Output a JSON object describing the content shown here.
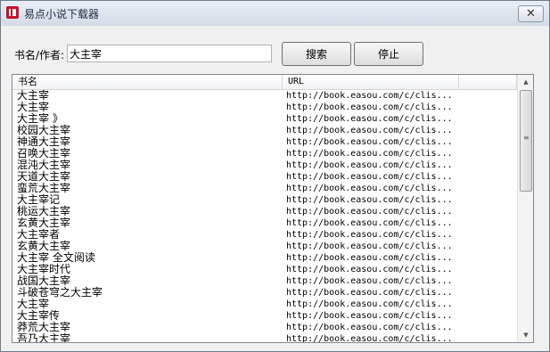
{
  "window": {
    "title": "易点小说下载器",
    "close_label": "✕"
  },
  "search": {
    "label": "书名/作者:",
    "value": "大主宰"
  },
  "buttons": {
    "search": "搜索",
    "stop": "停止"
  },
  "table": {
    "headers": {
      "name": "书名",
      "url": "URL",
      "extra": ""
    },
    "rows": [
      {
        "name": "大主宰",
        "url": "http://book.easou.com/c/clis..."
      },
      {
        "name": "大主宰",
        "url": "http://book.easou.com/c/clis..."
      },
      {
        "name": "大主宰 》",
        "url": "http://book.easou.com/c/clis..."
      },
      {
        "name": "校园大主宰",
        "url": "http://book.easou.com/c/clis..."
      },
      {
        "name": "神通大主宰",
        "url": "http://book.easou.com/c/clis..."
      },
      {
        "name": "召唤大主宰",
        "url": "http://book.easou.com/c/clis..."
      },
      {
        "name": "混沌大主宰",
        "url": "http://book.easou.com/c/clis..."
      },
      {
        "name": "天道大主宰",
        "url": "http://book.easou.com/c/clis..."
      },
      {
        "name": "蛮荒大主宰",
        "url": "http://book.easou.com/c/clis..."
      },
      {
        "name": "大主宰记",
        "url": "http://book.easou.com/c/clis..."
      },
      {
        "name": "桃运大主宰",
        "url": "http://book.easou.com/c/clis..."
      },
      {
        "name": "玄黄大主宰",
        "url": "http://book.easou.com/c/clis..."
      },
      {
        "name": "大主宰者",
        "url": "http://book.easou.com/c/clis..."
      },
      {
        "name": "玄黄大主宰",
        "url": "http://book.easou.com/c/clis..."
      },
      {
        "name": "大主宰 全文阅读",
        "url": "http://book.easou.com/c/clis..."
      },
      {
        "name": "大主宰时代",
        "url": "http://book.easou.com/c/clis..."
      },
      {
        "name": "战国大主宰",
        "url": "http://book.easou.com/c/clis..."
      },
      {
        "name": "斗破苍穹之大主宰",
        "url": "http://book.easou.com/c/clis..."
      },
      {
        "name": "大主宰",
        "url": "http://book.easou.com/c/clis..."
      },
      {
        "name": "大主宰传",
        "url": "http://book.easou.com/c/clis..."
      },
      {
        "name": "莽荒大主宰",
        "url": "http://book.easou.com/c/clis..."
      },
      {
        "name": "吾乃大主宰",
        "url": "http://book.easou.com/c/clis..."
      }
    ]
  },
  "scrollbar": {
    "up_glyph": "▲",
    "down_glyph": "▼",
    "grip_glyph": "≡"
  },
  "icons": {
    "app": "app-logo-icon",
    "close": "close-icon"
  },
  "colors": {
    "app_icon": "#c8102e",
    "titlebar": "#d4dbe6",
    "window_bg": "#f0f0f0"
  }
}
